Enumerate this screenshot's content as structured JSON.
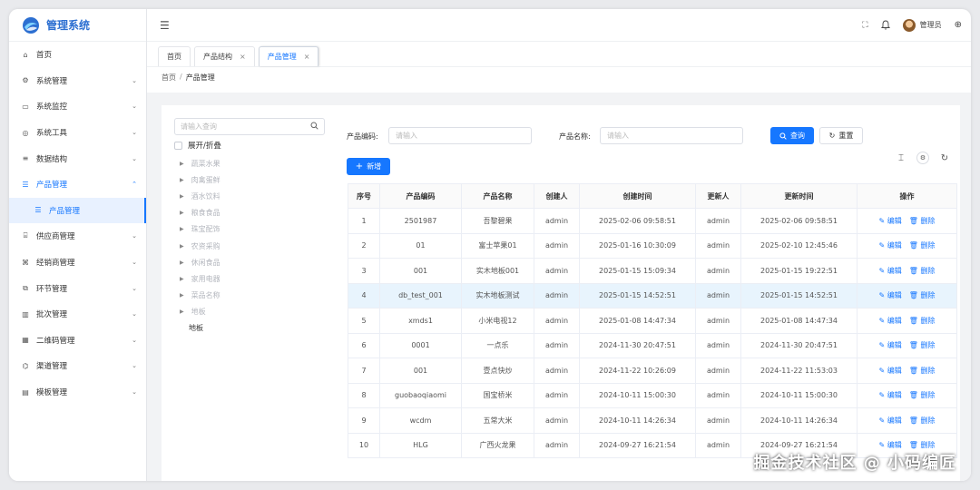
{
  "app": {
    "title": "管理系统"
  },
  "sidebar": {
    "items": [
      {
        "label": "首页",
        "icon": "home-icon",
        "glyph": "⌂",
        "chevron": ""
      },
      {
        "label": "系统管理",
        "icon": "gear-icon",
        "glyph": "⚙",
        "chevron": "⌄"
      },
      {
        "label": "系统监控",
        "icon": "monitor-icon",
        "glyph": "▭",
        "chevron": "⌄"
      },
      {
        "label": "系统工具",
        "icon": "tool-icon",
        "glyph": "◎",
        "chevron": "⌄"
      },
      {
        "label": "数据结构",
        "icon": "sliders-icon",
        "glyph": "≡",
        "chevron": "⌄"
      },
      {
        "label": "产品管理",
        "icon": "list-icon",
        "glyph": "☰",
        "chevron": "⌃",
        "open": true
      },
      {
        "label": "产品管理",
        "icon": "list-icon",
        "glyph": "☰",
        "chevron": "",
        "sub": true
      },
      {
        "label": "供应商管理",
        "icon": "supplier-icon",
        "glyph": "⌸",
        "chevron": "⌄"
      },
      {
        "label": "经销商管理",
        "icon": "dealer-icon",
        "glyph": "⌘",
        "chevron": "⌄"
      },
      {
        "label": "环节管理",
        "icon": "link-icon",
        "glyph": "⧉",
        "chevron": "⌄"
      },
      {
        "label": "批次管理",
        "icon": "barcode-icon",
        "glyph": "▥",
        "chevron": "⌄"
      },
      {
        "label": "二维码管理",
        "icon": "qrcode-icon",
        "glyph": "▦",
        "chevron": "⌄"
      },
      {
        "label": "渠道管理",
        "icon": "channel-icon",
        "glyph": "⌬",
        "chevron": "⌄"
      },
      {
        "label": "模板管理",
        "icon": "template-icon",
        "glyph": "▤",
        "chevron": "⌄"
      }
    ]
  },
  "header": {
    "fold_glyph": "☰",
    "fullscreen_glyph": "⛶",
    "bell_glyph": "🔔",
    "user_name": "管理员",
    "globe_glyph": "⊕"
  },
  "tabs": [
    {
      "label": "首页",
      "closable": false
    },
    {
      "label": "产品结构",
      "closable": true
    },
    {
      "label": "产品管理",
      "closable": true,
      "active": true
    }
  ],
  "breadcrumb": {
    "home": "首页",
    "sep": "/",
    "current": "产品管理"
  },
  "tree": {
    "search_placeholder": "请输入查询",
    "expand_label": "展开/折叠",
    "nodes": [
      "蔬菜水果",
      "肉禽蛋鲜",
      "酒水饮料",
      "粮食食品",
      "珠宝配饰",
      "农资采购",
      "休闲食品",
      "家用电器",
      "菜品名称",
      "地板"
    ],
    "leaf": "地板"
  },
  "filters": {
    "code_label": "产品编码:",
    "code_placeholder": "请输入",
    "name_label": "产品名称:",
    "name_placeholder": "请输入",
    "search_btn": "查询",
    "reset_btn": "重置",
    "add_btn": "新增"
  },
  "table": {
    "columns": [
      "序号",
      "产品编码",
      "产品名称",
      "创建人",
      "创建时间",
      "更新人",
      "更新时间",
      "操作"
    ],
    "edit_label": "编辑",
    "delete_label": "删除",
    "rows": [
      [
        "1",
        "2501987",
        "吾黎碧果",
        "admin",
        "2025-02-06 09:58:51",
        "admin",
        "2025-02-06 09:58:51"
      ],
      [
        "2",
        "01",
        "富士苹果01",
        "admin",
        "2025-01-16 10:30:09",
        "admin",
        "2025-02-10 12:45:46"
      ],
      [
        "3",
        "001",
        "实木地板001",
        "admin",
        "2025-01-15 15:09:34",
        "admin",
        "2025-01-15 19:22:51"
      ],
      [
        "4",
        "db_test_001",
        "实木地板测试",
        "admin",
        "2025-01-15 14:52:51",
        "admin",
        "2025-01-15 14:52:51"
      ],
      [
        "5",
        "xmds1",
        "小米电视12",
        "admin",
        "2025-01-08 14:47:34",
        "admin",
        "2025-01-08 14:47:34"
      ],
      [
        "6",
        "0001",
        "一点乐",
        "admin",
        "2024-11-30 20:47:51",
        "admin",
        "2024-11-30 20:47:51"
      ],
      [
        "7",
        "001",
        "壹点快炒",
        "admin",
        "2024-11-22 10:26:09",
        "admin",
        "2024-11-22 11:53:03"
      ],
      [
        "8",
        "guobaoqiaomi",
        "国宝桥米",
        "admin",
        "2024-10-11 15:00:30",
        "admin",
        "2024-10-11 15:00:30"
      ],
      [
        "9",
        "wcdm",
        "五常大米",
        "admin",
        "2024-10-11 14:26:34",
        "admin",
        "2024-10-11 14:26:34"
      ],
      [
        "10",
        "HLG",
        "广西火龙果",
        "admin",
        "2024-09-27 16:21:54",
        "admin",
        "2024-09-27 16:21:54"
      ]
    ],
    "highlight_row": 3
  },
  "watermark": "掘金技术社区 @ 小码编匠",
  "colors": {
    "accent": "#1677ff",
    "logo": "#2c6fd1"
  }
}
